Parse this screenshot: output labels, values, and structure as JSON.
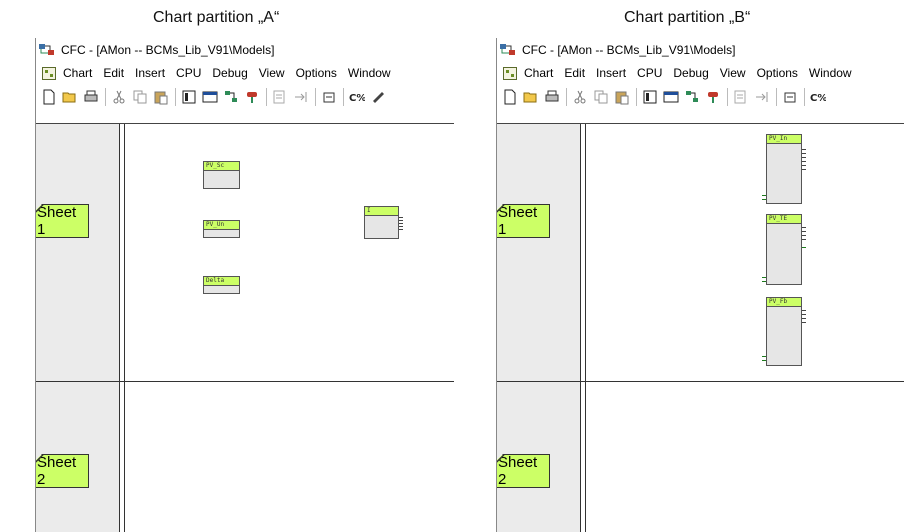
{
  "captions": {
    "a": "Chart partition „A“",
    "b": "Chart partition „B“"
  },
  "window_title": "CFC - [AMon -- BCMs_Lib_V91\\Models]",
  "menu": [
    "Chart",
    "Edit",
    "Insert",
    "CPU",
    "Debug",
    "View",
    "Options",
    "Window"
  ],
  "toolbar_icons": [
    "new-file-icon",
    "open-folder-icon",
    "print-icon",
    "cut-icon",
    "copy-icon",
    "paste-icon",
    "catalog-icon",
    "overview-icon",
    "block-icon",
    "connect-icon",
    "compile-icon",
    "go-to-icon",
    "sheet-bar-icon",
    "compare-icon"
  ],
  "sheets": [
    "Sheet 1",
    "Sheet 2"
  ],
  "blocks_a": [
    {
      "label": "PV_Sc"
    },
    {
      "label": "PV_Un"
    },
    {
      "label": "Delta"
    },
    {
      "label": "I"
    }
  ],
  "blocks_b": [
    {
      "label": "PV_In"
    },
    {
      "label": "PV_TE"
    },
    {
      "label": "PV_Fb"
    }
  ],
  "colors": {
    "accent_green": "#ccff66",
    "sheet_column": "#ebebeb",
    "block_body": "#e6e6e6"
  }
}
